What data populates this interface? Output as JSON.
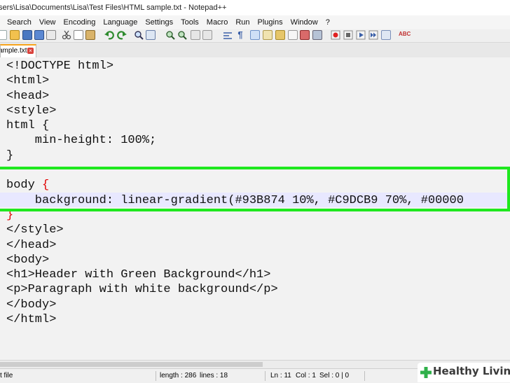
{
  "window": {
    "title": "sers\\Lisa\\Documents\\Lisa\\Test Files\\HTML sample.txt - Notepad++"
  },
  "menu": {
    "items": [
      "Search",
      "View",
      "Encoding",
      "Language",
      "Settings",
      "Tools",
      "Macro",
      "Run",
      "Plugins",
      "Window",
      "?"
    ]
  },
  "toolbar": {
    "icons": [
      "new-file-icon",
      "open-file-icon",
      "save-icon",
      "save-all-icon",
      "close-icon",
      "close-all-icon",
      "print-icon",
      "cut-icon",
      "copy-icon",
      "paste-icon",
      "undo-icon",
      "redo-icon",
      "find-icon",
      "replace-icon",
      "zoom-in-icon",
      "zoom-out-icon",
      "sync-vertical-icon",
      "sync-horizontal-icon",
      "word-wrap-icon",
      "show-all-chars-icon",
      "indent-guide-icon",
      "language-icon",
      "folder-icon",
      "function-list-icon",
      "monitor-icon",
      "record-macro-icon",
      "stop-macro-icon",
      "play-macro-icon",
      "run-macro-multiple-icon",
      "save-macro-icon",
      "spellcheck-icon"
    ]
  },
  "tab": {
    "label": "ample.txt"
  },
  "editor": {
    "lines": [
      "<!DOCTYPE html>",
      "<html>",
      "<head>",
      "<style>",
      "html {",
      "    min-height: 100%;",
      "}",
      "",
      "body {",
      "    background: linear-gradient(#93B874 10%, #C9DCB9 70%, #00000",
      "}",
      "</style>",
      "</head>",
      "<body>",
      "<h1>Header with Green Background</h1>",
      "<p>Paragraph with white background</p>",
      "</body>",
      "</html>"
    ],
    "highlight_color": "#1fe81f",
    "brace_color": "#e00000"
  },
  "status": {
    "file_type": "t file",
    "length": "length : 286",
    "lines": "lines : 18",
    "ln": "Ln : 11",
    "col": "Col : 1",
    "sel": "Sel : 0 | 0"
  },
  "watermark": {
    "text": "Healthy Living"
  }
}
